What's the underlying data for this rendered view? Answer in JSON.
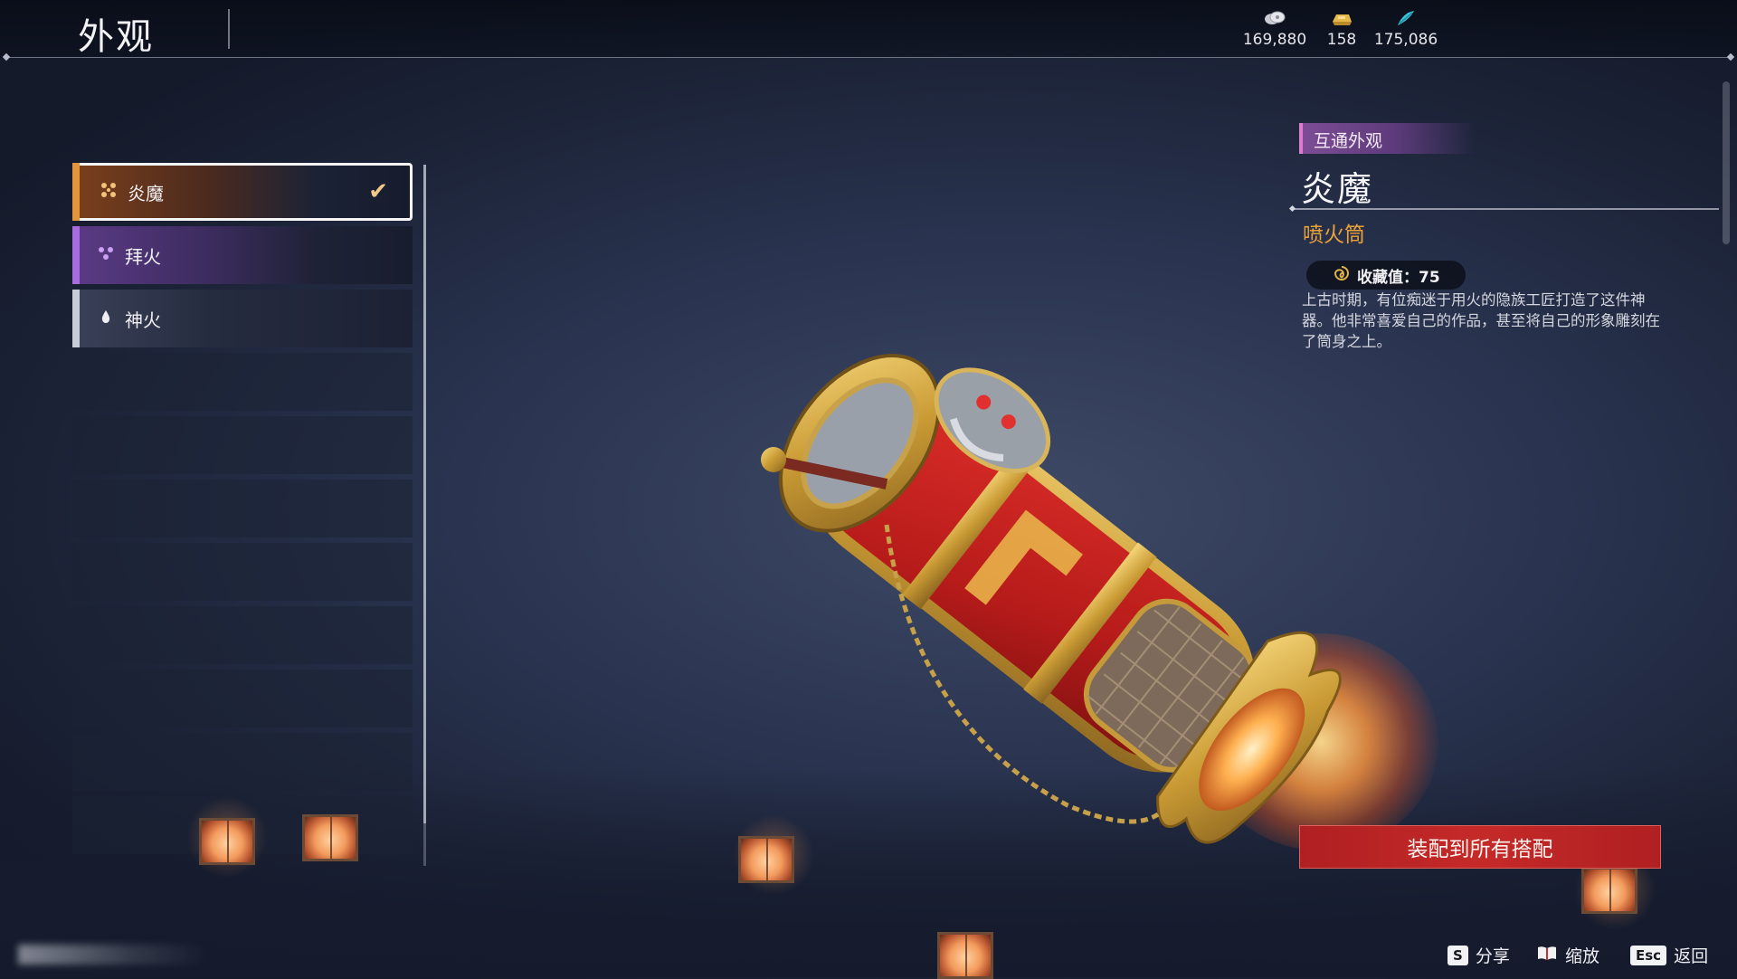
{
  "header": {
    "title": "外观",
    "currencies": [
      {
        "icon": "silver-coin-icon",
        "value": "169,880"
      },
      {
        "icon": "gold-ingot-icon",
        "value": "158"
      },
      {
        "icon": "jade-feather-icon",
        "value": "175,086"
      }
    ]
  },
  "skins": [
    {
      "icon": "flame-demon-icon",
      "label": "炎魔",
      "selected": true,
      "rarity_color": "#e3953b"
    },
    {
      "icon": "triple-petal-icon",
      "label": "拜火",
      "selected": false,
      "rarity_color": "#a66ce0"
    },
    {
      "icon": "drop-icon",
      "label": "神火",
      "selected": false,
      "rarity_color": "#c9ccd6"
    }
  ],
  "detail": {
    "tag": "互通外观",
    "name": "炎魔",
    "type": "喷火筒",
    "collect_value": "收藏值：75",
    "description": "上古时期，有位痴迷于用火的隐族工匠打造了这件神器。他非常喜爱自己的作品，甚至将自己的形象雕刻在了筒身之上。"
  },
  "actions": {
    "equip_all": "装配到所有搭配"
  },
  "hints": [
    {
      "key": "S",
      "label": "分享"
    },
    {
      "key": "📖",
      "label": "缩放"
    },
    {
      "key": "Esc",
      "label": "返回"
    }
  ]
}
